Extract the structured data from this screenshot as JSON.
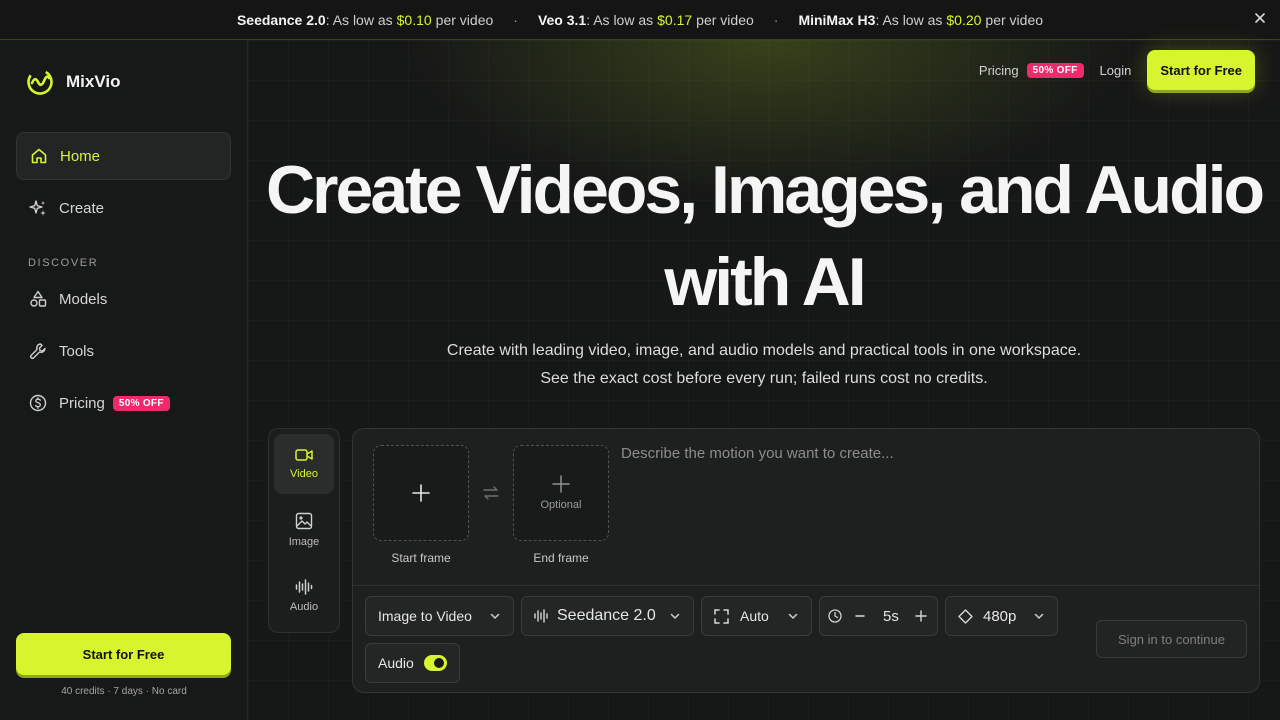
{
  "banner": {
    "promos": [
      {
        "model": "Seedance 2.0",
        "text1": ": As low as",
        "price": "$0.10",
        "text2": "per video"
      },
      {
        "model": "Veo 3.1",
        "text1": ": As low as",
        "price": "$0.17",
        "text2": "per video"
      },
      {
        "model": "MiniMax H3",
        "text1": ": As low as",
        "price": "$0.20",
        "text2": "per video"
      }
    ],
    "separator": "·"
  },
  "brand": {
    "name": "MixVio",
    "accent": "#d7f52f",
    "badge_color": "#ee2a6b"
  },
  "sidebar": {
    "items": [
      {
        "label": "Home",
        "icon": "home-icon"
      },
      {
        "label": "Create",
        "icon": "sparkles-icon"
      }
    ],
    "section_label": "DISCOVER",
    "discover": [
      {
        "label": "Models",
        "icon": "shapes-icon"
      },
      {
        "label": "Tools",
        "icon": "wrench-icon"
      },
      {
        "label": "Pricing",
        "icon": "dollar-icon",
        "badge": "50% OFF"
      }
    ],
    "cta": "Start for Free",
    "note": "40 credits · 7 days · No card"
  },
  "topnav": {
    "pricing": "Pricing",
    "pricing_badge": "50% OFF",
    "login": "Login",
    "cta": "Start for Free"
  },
  "hero": {
    "title_line1": "Create Videos, Images, and Audio",
    "title_line2": "with AI",
    "sub_line1": "Create with leading video, image, and audio models and practical tools in one workspace.",
    "sub_line2": "See the exact cost before every run; failed runs cost no credits."
  },
  "modes": [
    {
      "label": "Video",
      "icon": "video-icon"
    },
    {
      "label": "Image",
      "icon": "image-icon"
    },
    {
      "label": "Audio",
      "icon": "audio-wave-icon"
    }
  ],
  "composer": {
    "start_frame": "Start frame",
    "end_frame": "End frame",
    "end_optional": "Optional",
    "prompt_placeholder": "Describe the motion you want to create...",
    "mode_select": "Image to Video",
    "model_select": "Seedance 2.0",
    "aspect_select": "Auto",
    "duration": "5s",
    "resolution": "480p",
    "audio_label": "Audio",
    "audio_on": true,
    "signin": "Sign in to continue"
  }
}
